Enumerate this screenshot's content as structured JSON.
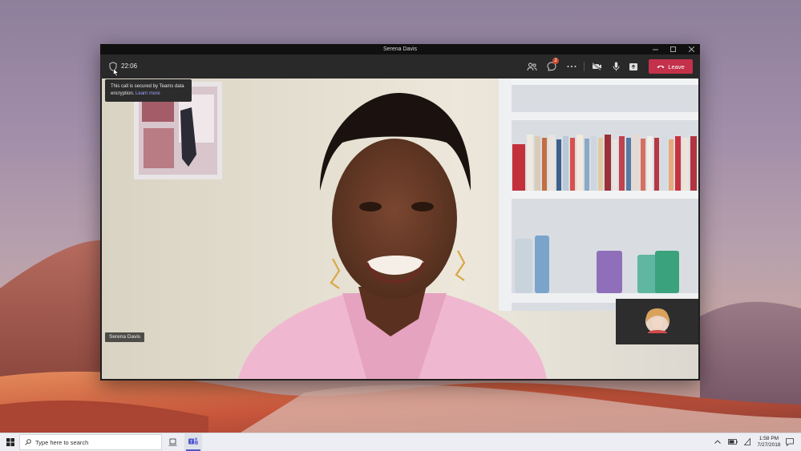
{
  "window": {
    "title": "Serena Davis"
  },
  "call": {
    "duration": "22:06",
    "chat_badge_count": "2",
    "leave_label": "Leave"
  },
  "tooltip": {
    "text": "This call is secured by Teams data encryption.",
    "link": "Learn more"
  },
  "participant": {
    "name": "Serena Davis"
  },
  "taskbar": {
    "search_placeholder": "Type here to search",
    "time": "1:58 PM",
    "date": "7/27/2018"
  },
  "colors": {
    "leave_button": "#c4314b",
    "accent": "#6264a7",
    "badge": "#cc4a31"
  },
  "icons": {
    "security": "shield-icon",
    "participants": "people-icon",
    "chat": "chat-icon",
    "more": "more-icon",
    "camera": "camera-off-icon",
    "mic": "mic-icon",
    "share": "share-icon",
    "leave": "phone-hangup-icon"
  }
}
